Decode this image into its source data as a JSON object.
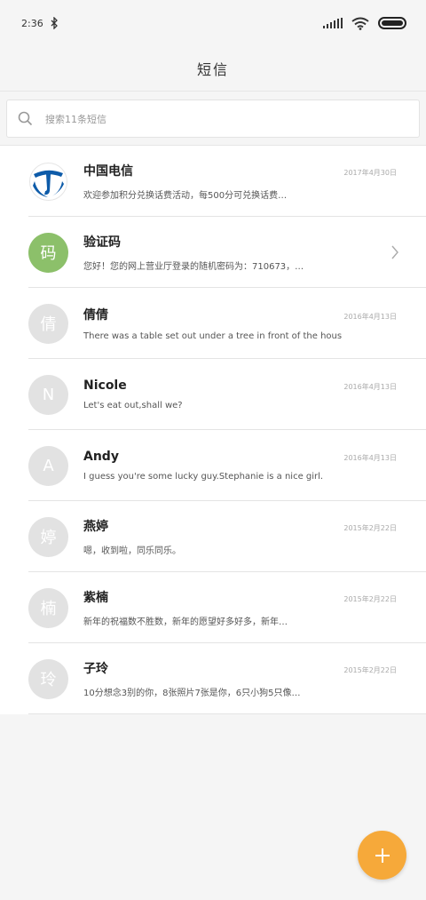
{
  "status_bar": {
    "time": "2:36",
    "bluetooth_icon": "bluetooth-icon",
    "signal_icon": "signal-icon",
    "wifi_icon": "wifi-icon",
    "battery_icon": "battery-icon"
  },
  "header": {
    "title": "短信"
  },
  "search": {
    "icon": "search-icon",
    "placeholder": "搜索11条短信"
  },
  "messages": [
    {
      "name": "中国电信",
      "date": "2017年4月30日",
      "preview": "欢迎参加积分兑换话费活动，每500分可兑换话费…",
      "avatar_text": "",
      "avatar_type": "china-telecom-logo"
    },
    {
      "name": "验证码",
      "date": "",
      "preview": "您好！您的网上营业厅登录的随机密码为：710673，…",
      "avatar_text": "码",
      "avatar_type": "green",
      "has_chevron": true
    },
    {
      "name": "倩倩",
      "date": "2016年4月13日",
      "preview": "There was a table set out under a tree in front of the hous",
      "avatar_text": "倩"
    },
    {
      "name": "Nicole",
      "date": "2016年4月13日",
      "preview": "Let's eat out,shall we?",
      "avatar_text": "N"
    },
    {
      "name": "Andy",
      "date": "2016年4月13日",
      "preview": "I guess you're some lucky guy.Stephanie is a nice girl.",
      "avatar_text": "A"
    },
    {
      "name": "燕婷",
      "date": "2015年2月22日",
      "preview": "嗯，收到啦，同乐同乐。",
      "avatar_text": "婷"
    },
    {
      "name": "紫楠",
      "date": "2015年2月22日",
      "preview": "新年的祝福数不胜数，新年的愿望好多好多，新年…",
      "avatar_text": "楠"
    },
    {
      "name": "子玲",
      "date": "2015年2月22日",
      "preview": "10分想念3别的你，8张照片7张是你，6只小狗5只像…",
      "avatar_text": "玲"
    }
  ],
  "fab": {
    "icon": "plus-icon"
  },
  "colors": {
    "accent": "#f6a93a",
    "verify_avatar": "#8cc06a",
    "avatar_default": "#e2e2e2",
    "telecom_blue": "#0d5ba9"
  }
}
